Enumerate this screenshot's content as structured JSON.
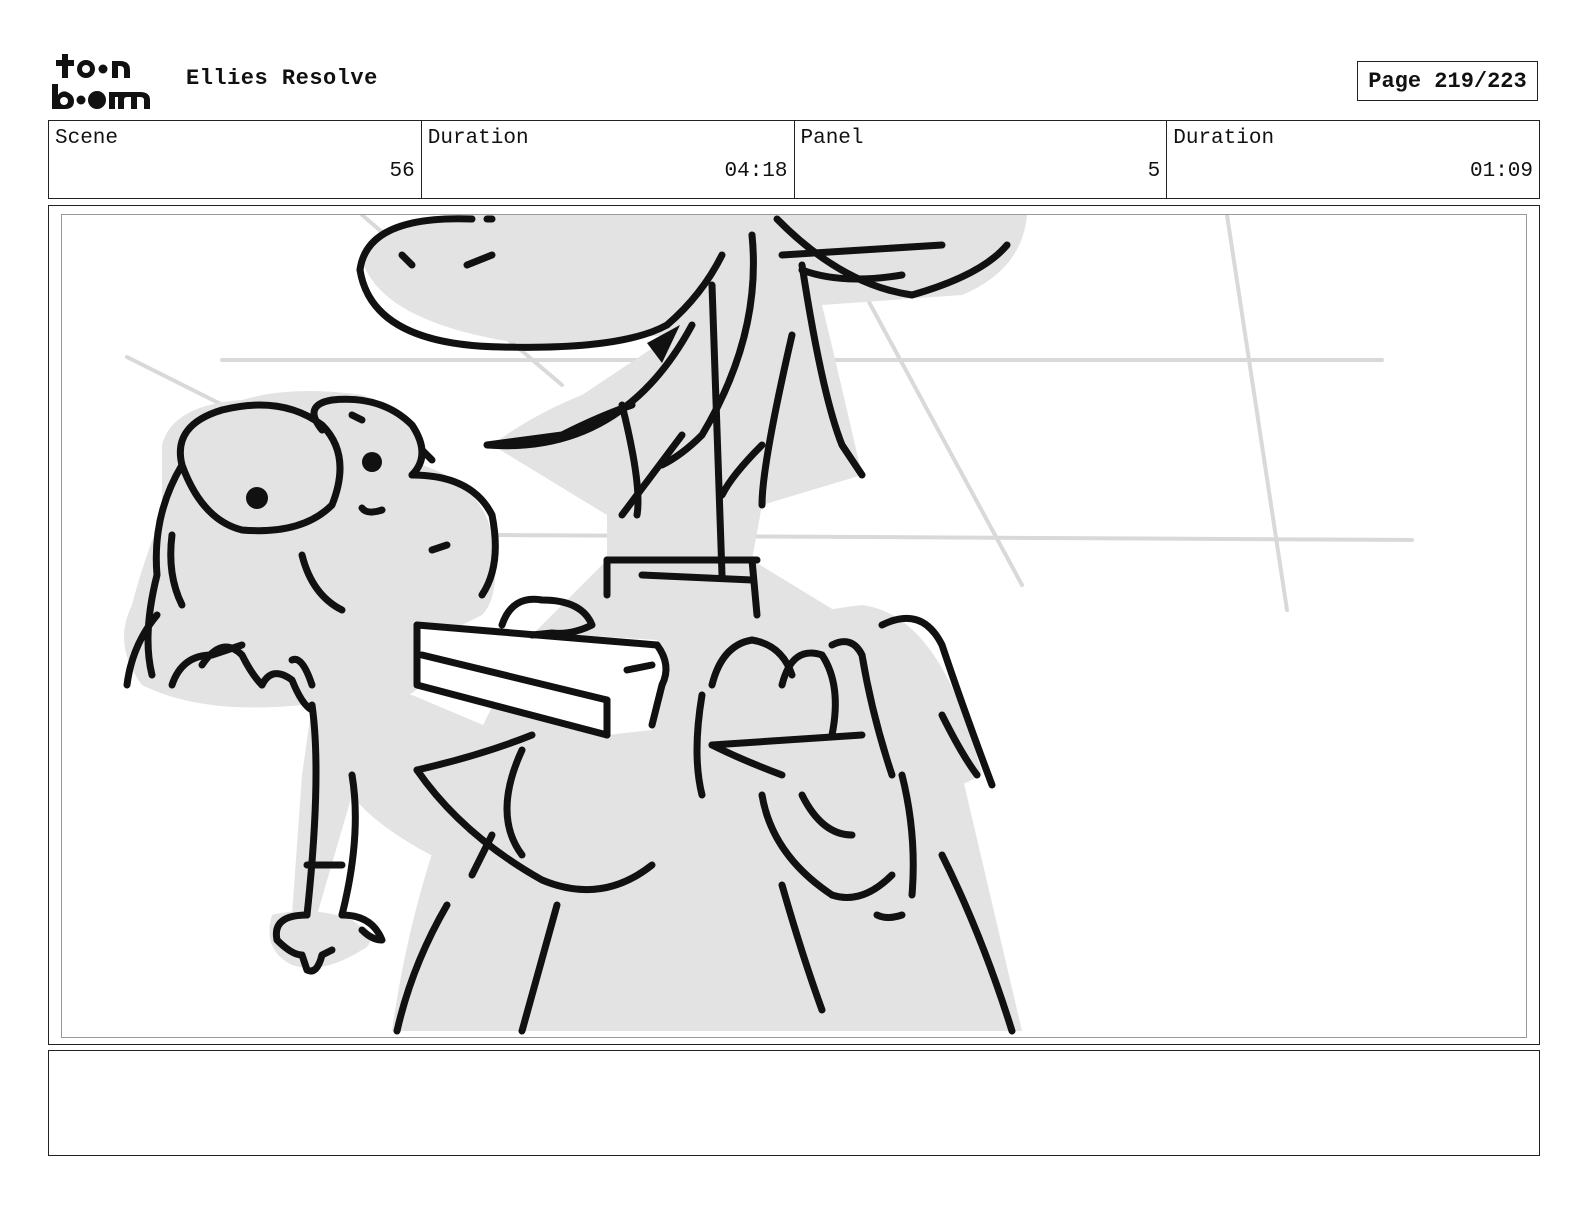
{
  "header": {
    "brand": "toon boom",
    "title": "Ellies Resolve",
    "page_label": "Page 219/223"
  },
  "info": {
    "scene_label": "Scene",
    "scene_value": "56",
    "scene_duration_label": "Duration",
    "scene_duration_value": "04:18",
    "panel_label": "Panel",
    "panel_value": "5",
    "panel_duration_label": "Duration",
    "panel_duration_value": "01:09"
  },
  "panel": {
    "image": "storyboard-sketch"
  },
  "notes": {
    "text": ""
  }
}
